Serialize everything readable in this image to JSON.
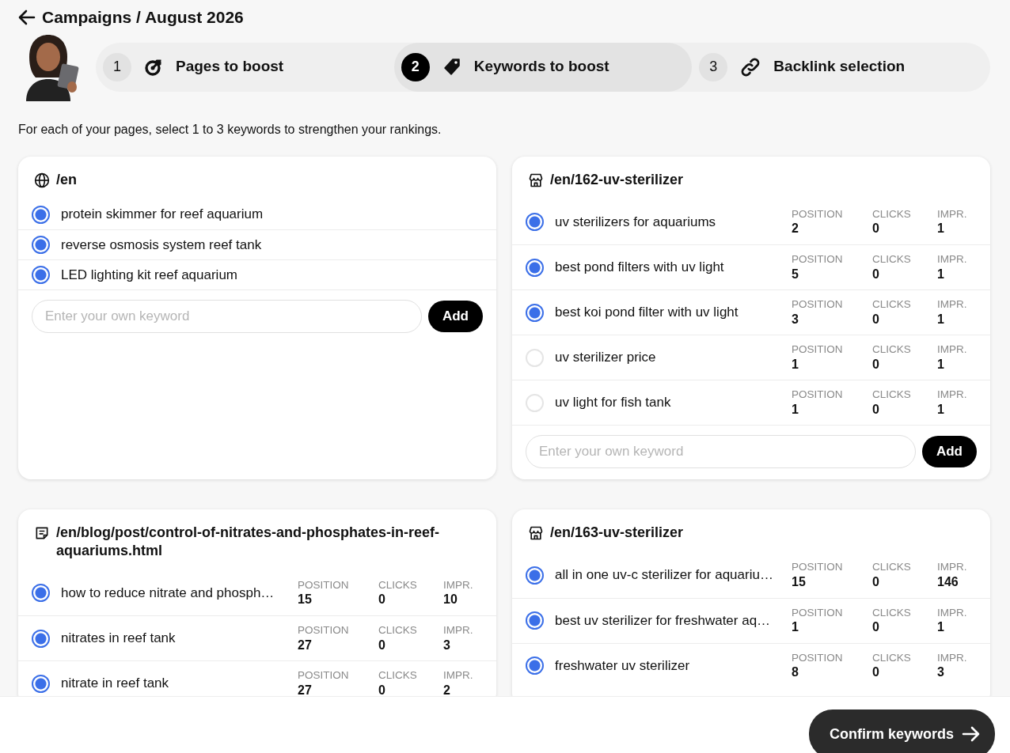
{
  "header": {
    "title": "Campaigns / August 2026"
  },
  "steps": [
    {
      "number": "1",
      "label": "Pages to boost",
      "kind": "target",
      "selected": false
    },
    {
      "number": "2",
      "label": "Keywords to boost",
      "kind": "tag",
      "selected": true
    },
    {
      "number": "3",
      "label": "Backlink selection",
      "kind": "link",
      "selected": false
    }
  ],
  "instruction": "For each of your pages, select 1 to 3 keywords to strengthen your rankings.",
  "pages": [
    {
      "path": "/en",
      "kind": "globe",
      "keywords": [
        {
          "text": "protein skimmer for reef aquarium",
          "selected": true
        },
        {
          "text": "reverse osmosis system reef tank",
          "selected": true
        },
        {
          "text": "LED lighting kit reef aquarium",
          "selected": true
        }
      ],
      "input": {
        "placeholder": "Enter your own keyword",
        "button": "Add"
      }
    },
    {
      "path": "/en/162-uv-sterilizer",
      "kind": "store",
      "keywords": [
        {
          "text": "uv sterilizers for aquariums",
          "selected": true,
          "stats": [
            {
              "label": "POSITION",
              "value": "2"
            },
            {
              "label": "CLICKS",
              "value": "0"
            },
            {
              "label": "IMPR.",
              "value": "1"
            }
          ]
        },
        {
          "text": "best pond filters with uv light",
          "selected": true,
          "stats": [
            {
              "label": "POSITION",
              "value": "5"
            },
            {
              "label": "CLICKS",
              "value": "0"
            },
            {
              "label": "IMPR.",
              "value": "1"
            }
          ]
        },
        {
          "text": "best koi pond filter with uv light",
          "selected": true,
          "stats": [
            {
              "label": "POSITION",
              "value": "3"
            },
            {
              "label": "CLICKS",
              "value": "0"
            },
            {
              "label": "IMPR.",
              "value": "1"
            }
          ]
        },
        {
          "text": "uv sterilizer price",
          "selected": false,
          "stats": [
            {
              "label": "POSITION",
              "value": "1"
            },
            {
              "label": "CLICKS",
              "value": "0"
            },
            {
              "label": "IMPR.",
              "value": "1"
            }
          ]
        },
        {
          "text": "uv light for fish tank",
          "selected": false,
          "stats": [
            {
              "label": "POSITION",
              "value": "1"
            },
            {
              "label": "CLICKS",
              "value": "0"
            },
            {
              "label": "IMPR.",
              "value": "1"
            }
          ]
        }
      ],
      "input": {
        "placeholder": "Enter your own keyword",
        "button": "Add"
      }
    },
    {
      "path": "/en/blog/post/control-of-nitrates-and-phosphates-in-reef-aquariums.html",
      "kind": "note",
      "keywords": [
        {
          "text": "how to reduce nitrate and phosph…",
          "selected": true,
          "stats": [
            {
              "label": "POSITION",
              "value": "15"
            },
            {
              "label": "CLICKS",
              "value": "0"
            },
            {
              "label": "IMPR.",
              "value": "10"
            }
          ]
        },
        {
          "text": "nitrates in reef tank",
          "selected": true,
          "stats": [
            {
              "label": "POSITION",
              "value": "27"
            },
            {
              "label": "CLICKS",
              "value": "0"
            },
            {
              "label": "IMPR.",
              "value": "3"
            }
          ]
        },
        {
          "text": "nitrate in reef tank",
          "selected": true,
          "stats": [
            {
              "label": "POSITION",
              "value": "27"
            },
            {
              "label": "CLICKS",
              "value": "0"
            },
            {
              "label": "IMPR.",
              "value": "2"
            }
          ]
        }
      ]
    },
    {
      "path": "/en/163-uv-sterilizer",
      "kind": "store",
      "keywords": [
        {
          "text": "all in one uv-c sterilizer for aquariu…",
          "selected": true,
          "stats": [
            {
              "label": "POSITION",
              "value": "15"
            },
            {
              "label": "CLICKS",
              "value": "0"
            },
            {
              "label": "IMPR.",
              "value": "146"
            }
          ]
        },
        {
          "text": "best uv sterilizer for freshwater aq…",
          "selected": true,
          "stats": [
            {
              "label": "POSITION",
              "value": "1"
            },
            {
              "label": "CLICKS",
              "value": "0"
            },
            {
              "label": "IMPR.",
              "value": "1"
            }
          ]
        },
        {
          "text": "freshwater uv sterilizer",
          "selected": true,
          "stats": [
            {
              "label": "POSITION",
              "value": "8"
            },
            {
              "label": "CLICKS",
              "value": "0"
            },
            {
              "label": "IMPR.",
              "value": "3"
            }
          ]
        }
      ]
    }
  ],
  "footer": {
    "button": "Confirm keywords"
  }
}
